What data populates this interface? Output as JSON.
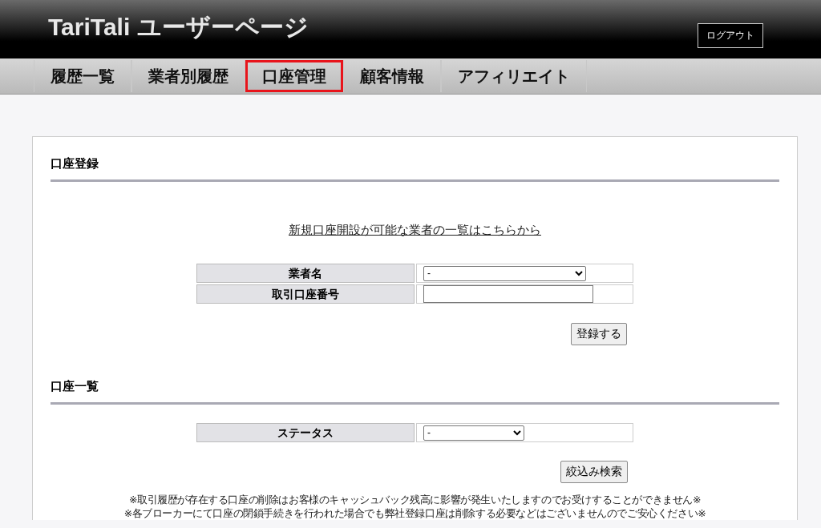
{
  "header": {
    "title": "TariTali ユーザーページ",
    "logout": "ログアウト"
  },
  "tabs": [
    {
      "label": "履歴一覧",
      "selected": false
    },
    {
      "label": "業者別履歴",
      "selected": false
    },
    {
      "label": "口座管理",
      "selected": true
    },
    {
      "label": "顧客情報",
      "selected": false
    },
    {
      "label": "アフィリエイト",
      "selected": false
    }
  ],
  "register": {
    "heading": "口座登録",
    "link": "新規口座開設が可能な業者の一覧はこちらから",
    "rows": [
      {
        "label": "業者名",
        "kind": "select",
        "value": "-"
      },
      {
        "label": "取引口座番号",
        "kind": "input"
      }
    ],
    "button": "登録する"
  },
  "list": {
    "heading": "口座一覧",
    "rows": [
      {
        "label": "ステータス",
        "kind": "select",
        "value": "-"
      }
    ],
    "button": "絞込み検索",
    "notes": [
      "※取引履歴が存在する口座の削除はお客様のキャッシュバック残高に影響が発生いたしますのでお受けすることができません※",
      "※各ブローカーにて口座の閉鎖手続きを行われた場合でも弊社登録口座は削除する必要などはございませんのでご安心ください※"
    ]
  }
}
